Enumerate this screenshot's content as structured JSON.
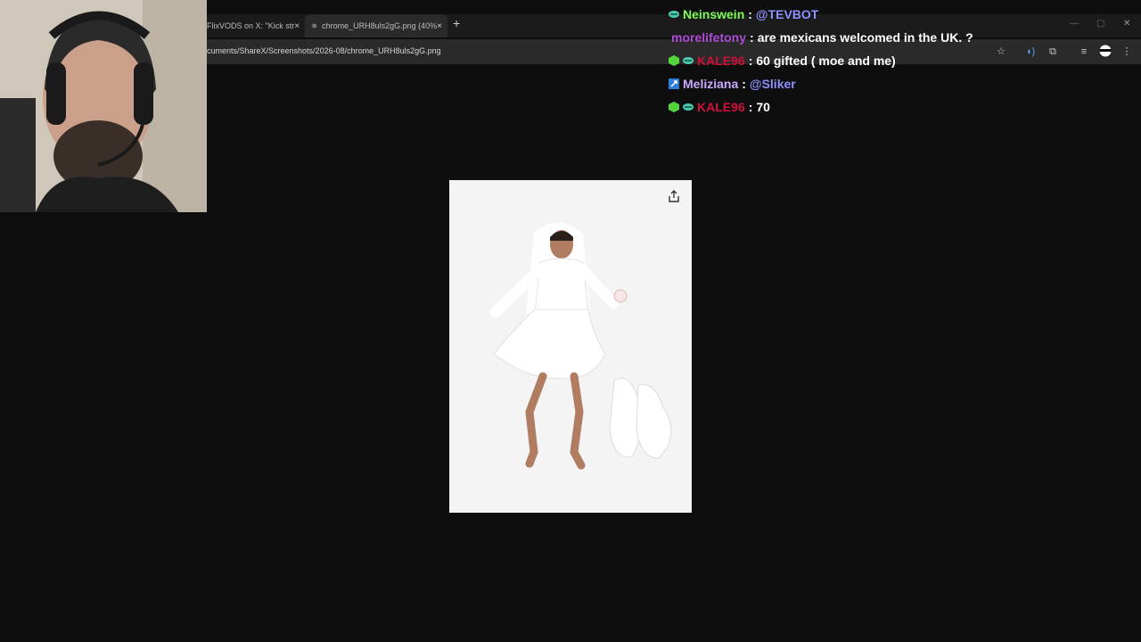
{
  "browser": {
    "tabs": [
      {
        "label": "FlixVODS on X: \"Kick str",
        "close": "×"
      },
      {
        "label": "chrome_URH8uls2gG.png (40%",
        "close": "×"
      }
    ],
    "new_tab": "+",
    "url": "cuments/ShareX/Screenshots/2026-08/chrome_URH8uls2gG.png"
  },
  "chat": {
    "messages": [
      {
        "user": "Neinswein",
        "user_color": "#7cfc55",
        "separator": ":",
        "text": "@TEVBOT",
        "text_is_mention": true
      },
      {
        "user": "morelifetony",
        "user_color": "#b04ad8",
        "separator": ":",
        "text": "are mexicans welcomed in the UK. ?",
        "text_is_mention": false
      },
      {
        "user": "KALE96",
        "user_color": "#d0103a",
        "separator": ":",
        "text": "60 gifted ( moe and me)",
        "text_is_mention": false
      },
      {
        "user": "Meliziana",
        "user_color": "#c9a8ff",
        "separator": ":",
        "text": "@Sliker",
        "text_is_mention": true
      },
      {
        "user": "KALE96",
        "user_color": "#d0103a",
        "separator": ":",
        "text": "70",
        "text_is_mention": false
      }
    ]
  },
  "viewer": {
    "share_icon": "share-icon"
  }
}
